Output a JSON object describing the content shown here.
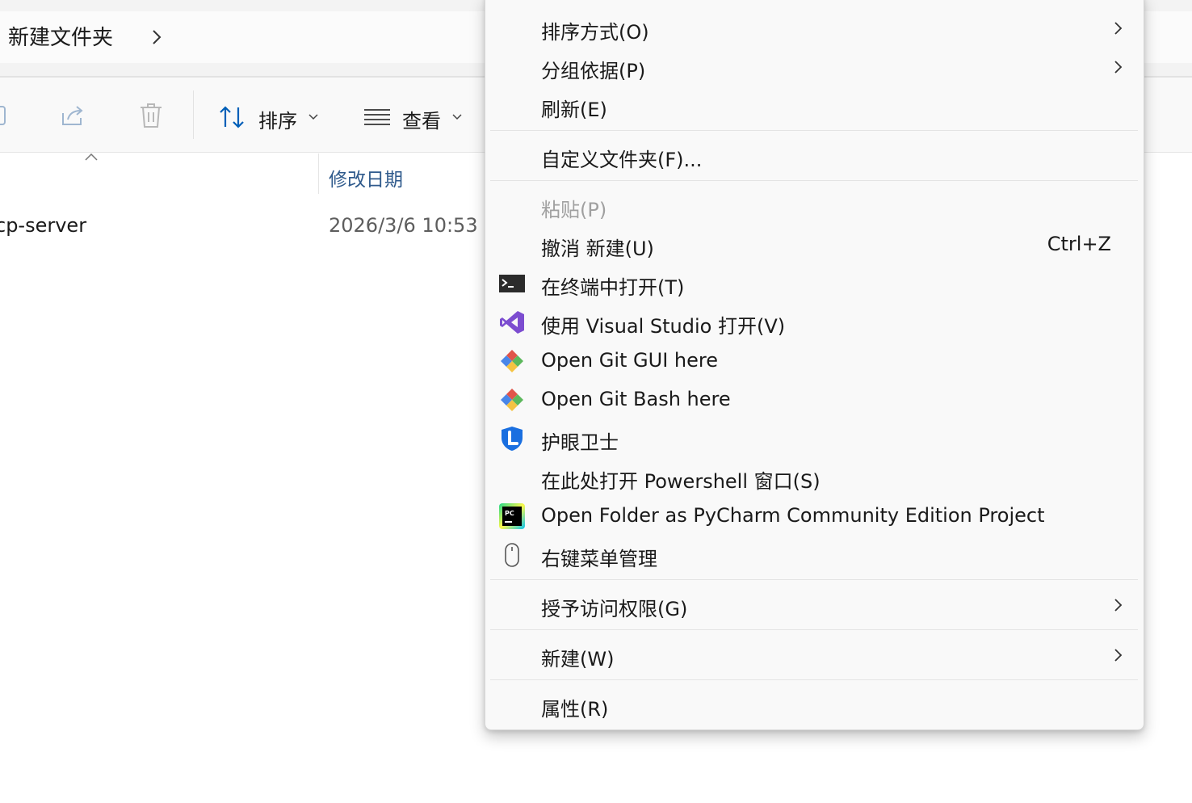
{
  "explorer": {
    "breadcrumb": "新建文件夹",
    "toolbar": {
      "sort_label": "排序",
      "view_label": "查看"
    },
    "columns": {
      "date_modified": "修改日期"
    },
    "file": {
      "name": "cp-server",
      "date": "2026/3/6 10:53"
    }
  },
  "menu": {
    "sort_by": "排序方式(O)",
    "group_by": "分组依据(P)",
    "refresh": "刷新(E)",
    "customize_folder": "自定义文件夹(F)...",
    "paste": "粘贴(P)",
    "undo_new": "撤消 新建(U)",
    "undo_shortcut": "Ctrl+Z",
    "open_terminal": "在终端中打开(T)",
    "open_visual_studio": "使用 Visual Studio 打开(V)",
    "git_gui": "Open Git GUI here",
    "git_bash": "Open Git Bash here",
    "eye_guard": "护眼卫士",
    "powershell": "在此处打开 Powershell 窗口(S)",
    "pycharm": "Open Folder as PyCharm Community Edition Project",
    "context_menu_manager": "右键菜单管理",
    "grant_access": "授予访问权限(G)",
    "new": "新建(W)",
    "properties": "属性(R)"
  },
  "icons": {
    "terminal": "terminal-icon",
    "visual_studio": "visual-studio-icon",
    "git": "git-icon",
    "eye_guard": "shield-icon",
    "pycharm": "pycharm-icon",
    "mouse": "mouse-icon"
  },
  "colors": {
    "accent": "#005fb8",
    "visual_studio": "#7c4dd0",
    "eye_guard": "#1a6fe0",
    "menu_bg": "#f9f9f9",
    "disabled_text": "#a0a0a0"
  }
}
